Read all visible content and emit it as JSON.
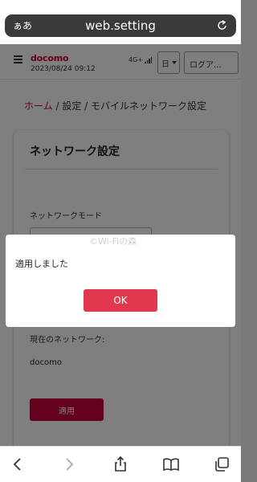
{
  "browser": {
    "aa_label": "ぁあ",
    "url": "web.setting"
  },
  "header": {
    "brand": "docomo",
    "datetime": "2023/08/24 09:12",
    "signal": "4G+",
    "language": "日",
    "login_label": "ログア..."
  },
  "breadcrumb": {
    "home": "ホーム",
    "rest": " / 設定 / モバイルネットワーク設定"
  },
  "card": {
    "title": "ネットワーク設定",
    "mode_label": "ネットワークモード",
    "current_label": "現在のネットワーク:",
    "current_value": "docomo",
    "apply_label": "適用"
  },
  "dialog": {
    "message": "適用しました",
    "watermark": "©Wi-Fiの森",
    "ok_label": "OK"
  },
  "colors": {
    "brand": "#cc0033",
    "ok_button": "#e0394f"
  }
}
